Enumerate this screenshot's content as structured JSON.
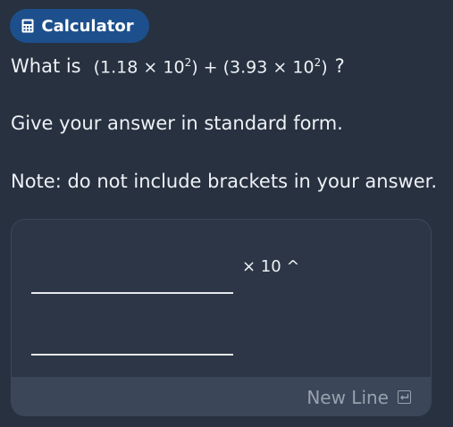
{
  "calculator_button": {
    "label": "Calculator",
    "icon": "calculator-icon"
  },
  "question": {
    "prefix": "What is",
    "term1_coef": "(1.18",
    "term1_times": "×",
    "term1_base": "10",
    "term1_exp": "2",
    "term1_close": ")",
    "plus": "+",
    "term2_coef": "(3.93",
    "term2_times": "×",
    "term2_base": "10",
    "term2_exp": "2",
    "term2_close": ")",
    "question_mark": "?"
  },
  "instruction": "Give your answer in standard form.",
  "note": "Note: do not include brackets in your answer.",
  "answer": {
    "times_label": "× 10 ^",
    "new_line_label": "New Line",
    "enter_icon": "enter-key-icon"
  },
  "colors": {
    "background": "#273140",
    "button_bg": "#1d4f8c",
    "panel_bg": "#2c3646",
    "new_line_bar": "#3b4658"
  }
}
